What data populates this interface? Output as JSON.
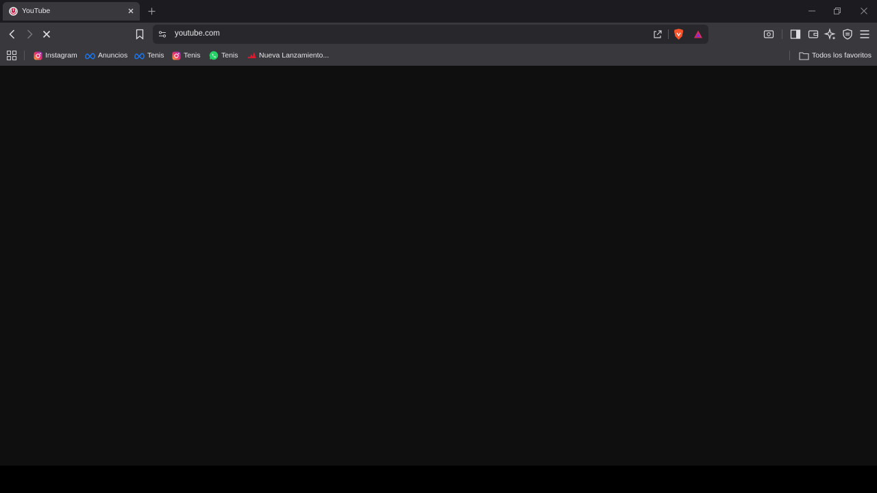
{
  "tab": {
    "title": "YouTube",
    "favicon": "brave-icon"
  },
  "window_controls": [
    "minimize-icon",
    "restore-icon",
    "close-icon"
  ],
  "toolbar": {
    "url": "youtube.com"
  },
  "bookmarks": {
    "items": [
      {
        "label": "Instagram",
        "icon": "instagram-icon"
      },
      {
        "label": "Anuncios",
        "icon": "meta-icon"
      },
      {
        "label": "Tenis",
        "icon": "meta-icon"
      },
      {
        "label": "Tenis",
        "icon": "instagram-icon"
      },
      {
        "label": "Tenis",
        "icon": "whatsapp-icon"
      },
      {
        "label": "Nueva Lanzamiento...",
        "icon": "adidas-icon"
      }
    ],
    "all_bookmarks_label": "Todos los favoritos"
  },
  "colors": {
    "tab_bg": "#38383d",
    "strip_bg": "#1c1c20",
    "content_bg": "#0f0f10",
    "brave_orange": "#fb542b"
  }
}
